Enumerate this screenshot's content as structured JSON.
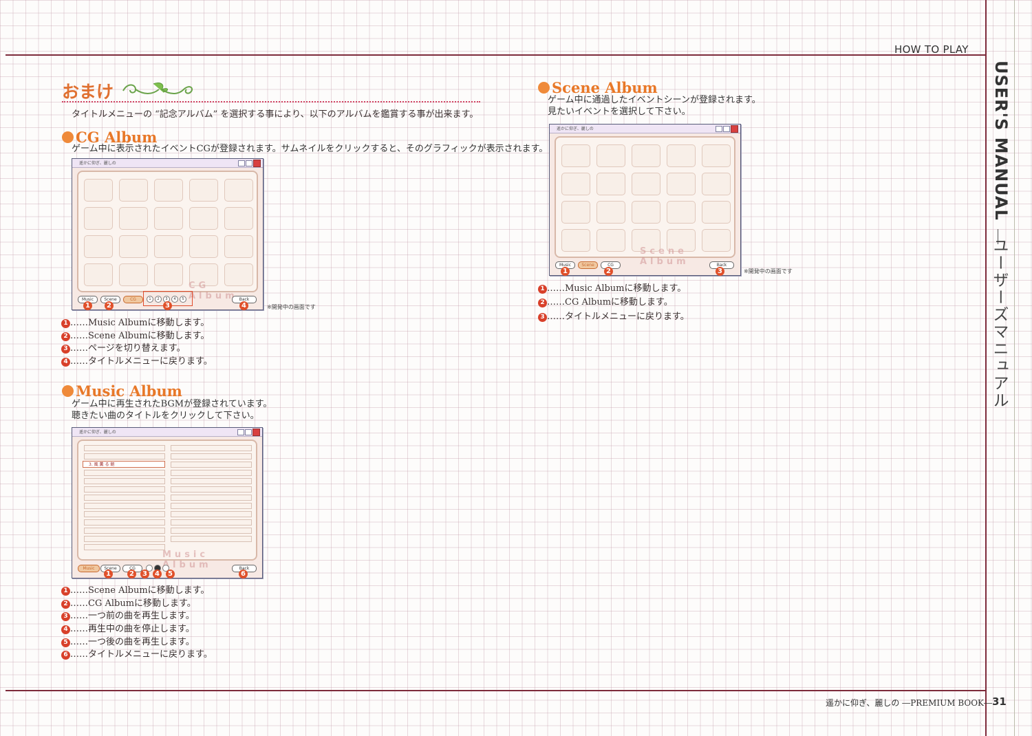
{
  "header": {
    "how_to_play": "HOW TO PLAY",
    "sidebar_title": "USER'S MANUAL",
    "sidebar_jp": "ユーザーズマニュアル"
  },
  "omake": {
    "title": "おまけ",
    "intro": "タイトルメニューの “記念アルバム” を選択する事により、以下のアルバムを鑑賞する事が出来ます。"
  },
  "cg": {
    "title": "CG Album",
    "desc": "ゲーム中に表示されたイベントCGが登録されます。サムネイルをクリックすると、そのグラフィックが表示されます。",
    "window_title": "遥かに仰ぎ、麗しの",
    "watermark": "CG Album",
    "buttons": {
      "music": "Music",
      "scene": "Scene",
      "cg": "CG",
      "back": "Back"
    },
    "pages": [
      "1",
      "2",
      "3",
      "4",
      "5"
    ],
    "caption": "※開発中の画面です",
    "items": [
      {
        "n": "1",
        "text": "……Music Albumに移動します。"
      },
      {
        "n": "2",
        "text": "……Scene Albumに移動します。"
      },
      {
        "n": "3",
        "text": "……ページを切り替えます。"
      },
      {
        "n": "4",
        "text": "……タイトルメニューに戻ります。"
      }
    ]
  },
  "music": {
    "title": "Music Album",
    "desc1": "ゲーム中に再生されたBGMが登録されています。",
    "desc2": "聴きたい曲のタイトルをクリックして下さい。",
    "window_title": "遥かに仰ぎ、麗しの",
    "watermark": "Music Album",
    "selected_track": "3. 風 薫 る 朝",
    "buttons": {
      "music": "Music",
      "scene": "Scene",
      "cg": "CG",
      "back": "Back"
    },
    "items": [
      {
        "n": "1",
        "text": "……Scene Albumに移動します。"
      },
      {
        "n": "2",
        "text": "……CG Albumに移動します。"
      },
      {
        "n": "3",
        "text": "……一つ前の曲を再生します。"
      },
      {
        "n": "4",
        "text": "……再生中の曲を停止します。"
      },
      {
        "n": "5",
        "text": "……一つ後の曲を再生します。"
      },
      {
        "n": "6",
        "text": "……タイトルメニューに戻ります。"
      }
    ]
  },
  "scene": {
    "title": "Scene Album",
    "desc1": "ゲーム中に通過したイベントシーンが登録されます。",
    "desc2": "見たいイベントを選択して下さい。",
    "window_title": "遥かに仰ぎ、麗しの",
    "watermark": "Scene Album",
    "buttons": {
      "music": "Music",
      "scene": "Scene",
      "cg": "CG",
      "back": "Back"
    },
    "caption": "※開発中の画面です",
    "items": [
      {
        "n": "1",
        "text": "……Music Albumに移動します。"
      },
      {
        "n": "2",
        "text": "……CG Albumに移動します。"
      },
      {
        "n": "3",
        "text": "……タイトルメニューに戻ります。"
      }
    ]
  },
  "footer": {
    "book": "遥かに仰ぎ、麗しの ―PREMIUM BOOK―",
    "page": "31"
  }
}
